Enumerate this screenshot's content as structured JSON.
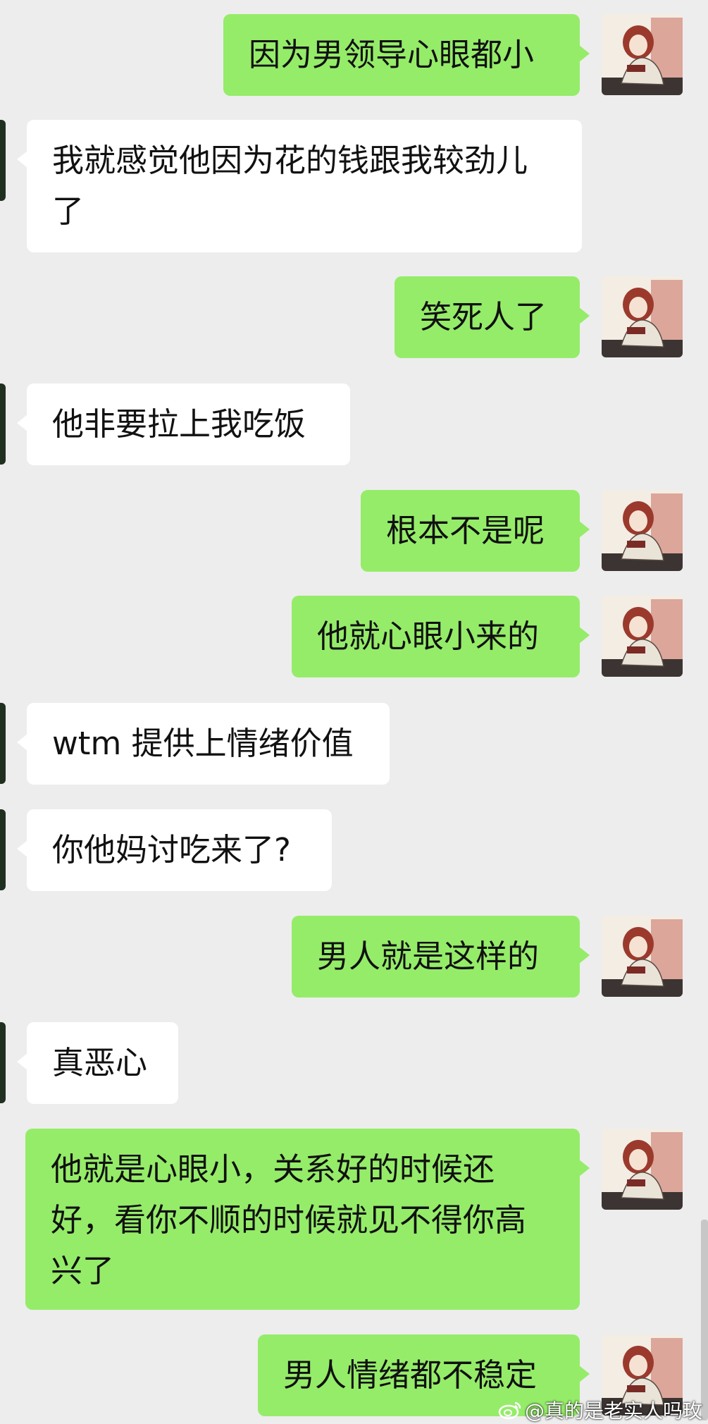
{
  "messages": [
    {
      "side": "right",
      "text": "因为男领导心眼都小"
    },
    {
      "side": "left",
      "text": "我就感觉他因为花的钱跟我较劲儿了"
    },
    {
      "side": "right",
      "text": "笑死人了"
    },
    {
      "side": "left",
      "text": "他非要拉上我吃饭"
    },
    {
      "side": "right",
      "text": "根本不是呢"
    },
    {
      "side": "right",
      "text": "他就心眼小来的"
    },
    {
      "side": "left",
      "text": "wtm 提供上情绪价值"
    },
    {
      "side": "left",
      "text": "你他妈讨吃来了?"
    },
    {
      "side": "right",
      "text": "男人就是这样的"
    },
    {
      "side": "left",
      "text": "真恶心"
    },
    {
      "side": "right",
      "text": "他就是心眼小，关系好的时候还好，看你不顺的时候就见不得你高兴了"
    },
    {
      "side": "right",
      "text": "男人情绪都不稳定"
    }
  ],
  "watermark": "@真的是老实人吗玫",
  "colors": {
    "background": "#ededed",
    "mine_bubble": "#95ec69",
    "theirs_bubble": "#ffffff"
  },
  "icons": {
    "watermark_logo": "weibo-icon",
    "my_avatar": "illustrated-girl-avatar",
    "contact_avatar": "dark-green-avatar"
  }
}
